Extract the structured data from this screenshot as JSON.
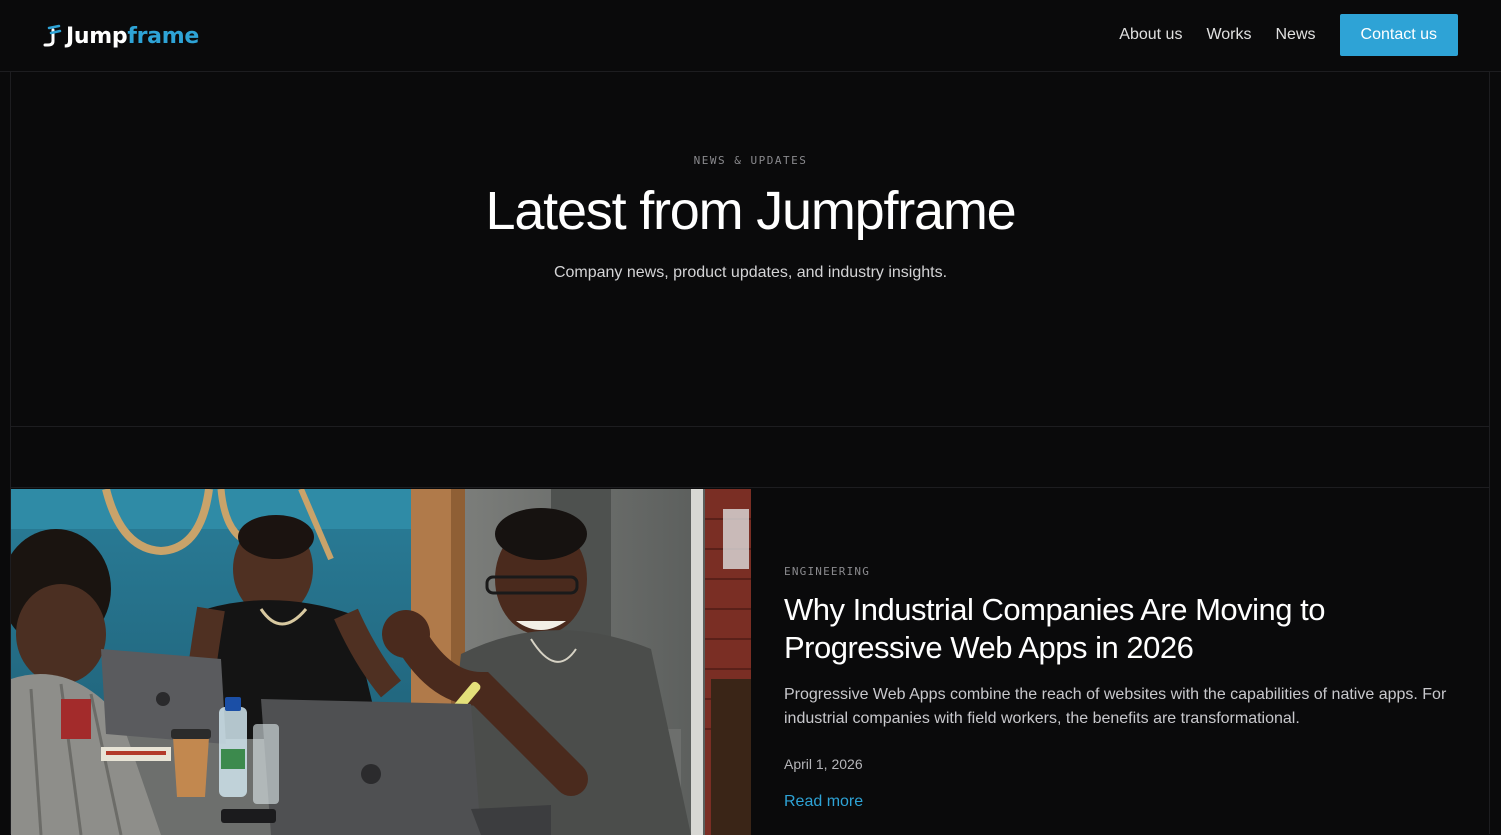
{
  "colors": {
    "background": "#0a0a0b",
    "accent": "#2ea3d6",
    "text": "#ffffff",
    "muted": "#8a8a8e"
  },
  "header": {
    "logo_part1": "Jump",
    "logo_part2": "frame",
    "nav": {
      "about": "About us",
      "works": "Works",
      "news": "News"
    },
    "cta": "Contact us"
  },
  "hero": {
    "eyebrow": "NEWS & UPDATES",
    "title": "Latest from Jumpframe",
    "subtitle": "Company news, product updates, and industry insights."
  },
  "article": {
    "category": "ENGINEERING",
    "title": "Why Industrial Companies Are Moving to Progressive Web Apps in 2026",
    "excerpt": "Progressive Web Apps combine the reach of websites with the capabilities of native apps. For industrial companies with field workers, the benefits are transformational.",
    "date": "April 1, 2026",
    "link": "Read more",
    "image_icon": "photo-people-laptops"
  }
}
